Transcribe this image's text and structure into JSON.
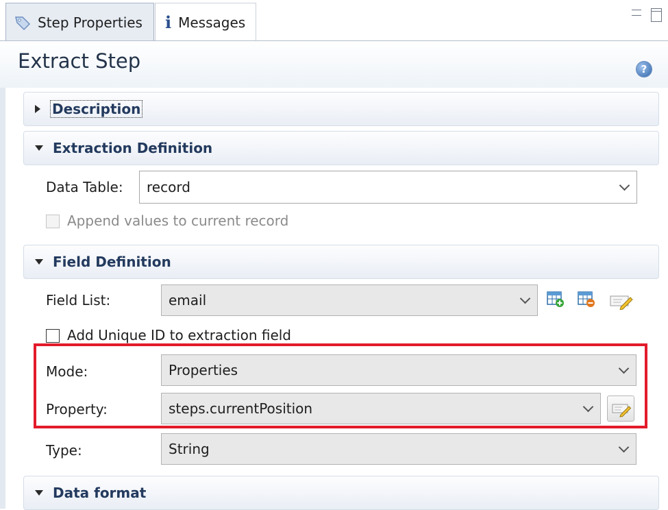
{
  "tabs": [
    {
      "label": "Step Properties",
      "icon": "tag-icon",
      "active": true
    },
    {
      "label": "Messages",
      "icon": "info-icon",
      "active": false
    }
  ],
  "title": "Extract Step",
  "sections": {
    "description": {
      "label": "Description",
      "expanded": false
    },
    "extraction": {
      "label": "Extraction Definition",
      "expanded": true,
      "data_table_label": "Data Table:",
      "data_table_value": "record",
      "append_label": "Append values to current record",
      "append_checked": false,
      "append_enabled": false
    },
    "field": {
      "label": "Field Definition",
      "expanded": true,
      "field_list_label": "Field List:",
      "field_list_value": "email",
      "unique_id_label": "Add Unique ID to extraction field",
      "unique_id_checked": false,
      "mode_label": "Mode:",
      "mode_value": "Properties",
      "property_label": "Property:",
      "property_value": "steps.currentPosition",
      "type_label": "Type:",
      "type_value": "String"
    },
    "data_format": {
      "label": "Data format",
      "expanded": true
    }
  },
  "colors": {
    "highlight": "#e21b2b",
    "section_text": "#233a5e",
    "tab_active": "#e7ecf3"
  }
}
